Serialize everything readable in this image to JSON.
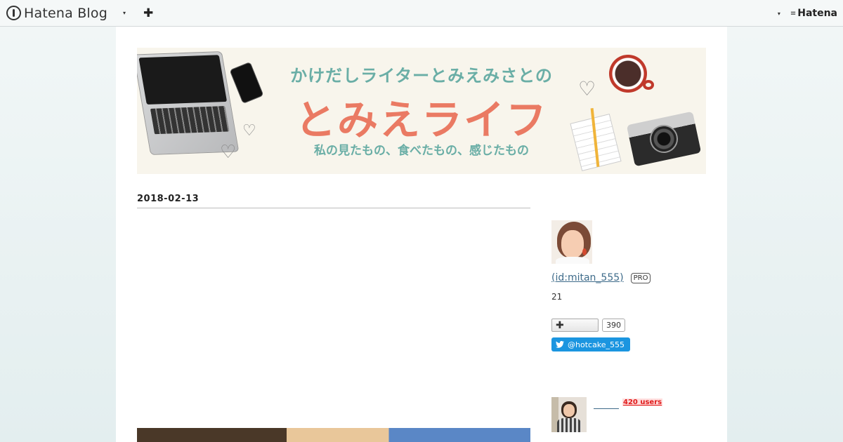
{
  "globalbar": {
    "logo_text": "Hatena Blog",
    "caret": "▾",
    "plus": "✚",
    "hatena_mark": "≡",
    "hatena_text": "Hatena"
  },
  "banner": {
    "subtitle": "かけだしライターとみえみさとの",
    "title": "とみえライフ",
    "tagline": "私の見たもの、食べたもの、感じたもの",
    "heart": "♡"
  },
  "entry": {
    "date": "2018-02-13"
  },
  "sidebar": {
    "profile_link": " (id:mitan_555)",
    "pro_badge": "PRO",
    "reader_count": "21",
    "subscribe_plus": "✚",
    "subscribe_count": "390",
    "twitter_handle": "@hotcake_555",
    "related_users": "420 users"
  },
  "colors": {
    "accent_teal": "#6aaea6",
    "accent_coral": "#ea7a63",
    "link": "#3e6b8a",
    "twitter": "#1b95e0",
    "users_badge": "#e01b1b"
  }
}
